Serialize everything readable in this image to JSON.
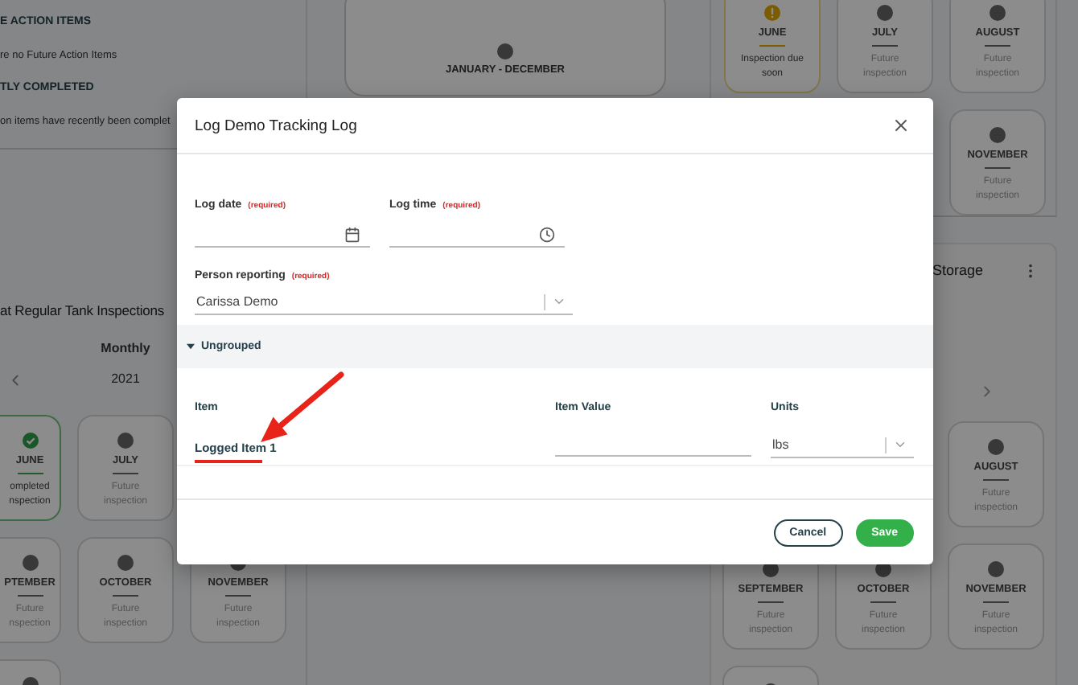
{
  "background": {
    "action_sections": [
      {
        "heading": "E ACTION ITEMS",
        "message": "re no Future Action Items"
      },
      {
        "heading": "TLY COMPLETED",
        "message": "on items have recently been complet"
      }
    ],
    "schedule": {
      "title": "at Regular Tank Inspections",
      "frequency": "Monthly",
      "year": "2021",
      "rows": [
        [
          {
            "kind": "completed",
            "name": "JUNE",
            "note": "ompleted\nnspection"
          },
          {
            "kind": "future",
            "name": "JULY",
            "note": "Future\ninspection"
          }
        ],
        [
          {
            "kind": "future",
            "name": "PTEMBER",
            "note": "Future\nnspection"
          },
          {
            "kind": "future",
            "name": "OCTOBER",
            "note": "Future\ninspection"
          },
          {
            "kind": "future",
            "name": "NOVEMBER",
            "note": "Future\ninspection"
          }
        ],
        [
          {
            "kind": "future"
          }
        ]
      ]
    },
    "year_card": {
      "label": "JANUARY - DECEMBER"
    },
    "top_panel": {
      "rows": [
        [
          {
            "kind": "due",
            "name": "JUNE",
            "note": "Inspection due\nsoon"
          },
          {
            "kind": "future",
            "name": "JULY",
            "note": "Future\ninspection"
          },
          {
            "kind": "future",
            "name": "AUGUST",
            "note": "Future\ninspection"
          }
        ],
        [
          "",
          "",
          {
            "kind": "future",
            "name": "NOVEMBER",
            "note": "Future\ninspection"
          }
        ]
      ]
    },
    "storage": {
      "title": "Storage",
      "rows": [
        [
          "",
          "",
          {
            "kind": "future",
            "name": "AUGUST",
            "note": "Future\ninspection"
          }
        ],
        [
          {
            "kind": "future",
            "name": "SEPTEMBER",
            "note": "Future\ninspection"
          },
          {
            "kind": "future",
            "name": "OCTOBER",
            "note": "Future\ninspection"
          },
          {
            "kind": "future",
            "name": "NOVEMBER",
            "note": "Future\ninspection"
          }
        ],
        [
          {
            "kind": "future"
          }
        ]
      ]
    }
  },
  "dialog": {
    "title": "Log Demo Tracking Log",
    "fields": [
      {
        "label": "Log date",
        "required": "(required)",
        "kind": "date"
      },
      {
        "label": "Log time",
        "required": "(required)",
        "kind": "time"
      }
    ],
    "person": {
      "label": "Person reporting",
      "required": "(required)",
      "value": "Carissa Demo"
    },
    "group": {
      "name": "Ungrouped",
      "expanded": true,
      "columns": [
        "Item",
        "Item Value",
        "Units"
      ],
      "rows": [
        {
          "item": "Logged Item 1",
          "units": "lbs",
          "highlighted": true
        }
      ]
    },
    "buttons": [
      {
        "label": "Cancel",
        "kind": "secondary"
      },
      {
        "label": "Save",
        "kind": "primary"
      }
    ]
  }
}
